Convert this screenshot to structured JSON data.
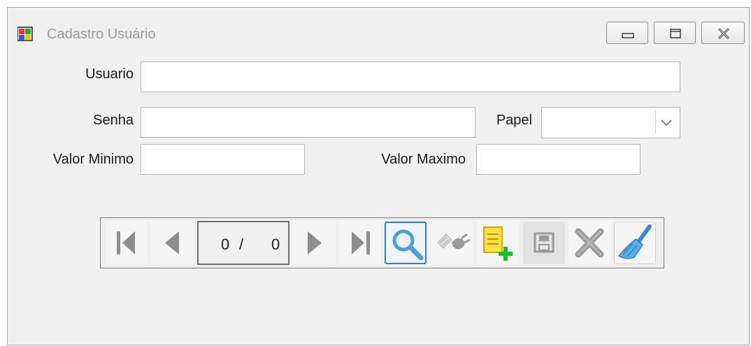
{
  "window": {
    "title": "Cadastro Usuário",
    "controls": {
      "minimize": "minimize",
      "maximize": "maximize",
      "close": "close"
    }
  },
  "form": {
    "usuario": {
      "label": "Usuario",
      "value": ""
    },
    "senha": {
      "label": "Senha",
      "value": ""
    },
    "papel": {
      "label": "Papel",
      "value": ""
    },
    "valor_minimo": {
      "label": "Valor Minimo",
      "value": ""
    },
    "valor_maximo": {
      "label": "Valor Maximo",
      "value": ""
    }
  },
  "navigator": {
    "current": "0",
    "separator": "/",
    "total": "0",
    "buttons": [
      "first-record-icon",
      "prior-record-icon",
      "next-record-icon",
      "last-record-icon",
      "search-icon",
      "connect-plug-icon",
      "insert-record-icon",
      "save-disk-icon",
      "delete-x-icon",
      "clear-broom-icon"
    ]
  },
  "colors": {
    "window_bg": "#f0f0f0",
    "accent_blue": "#2a7fd4",
    "title_text": "#9a9a9a"
  }
}
